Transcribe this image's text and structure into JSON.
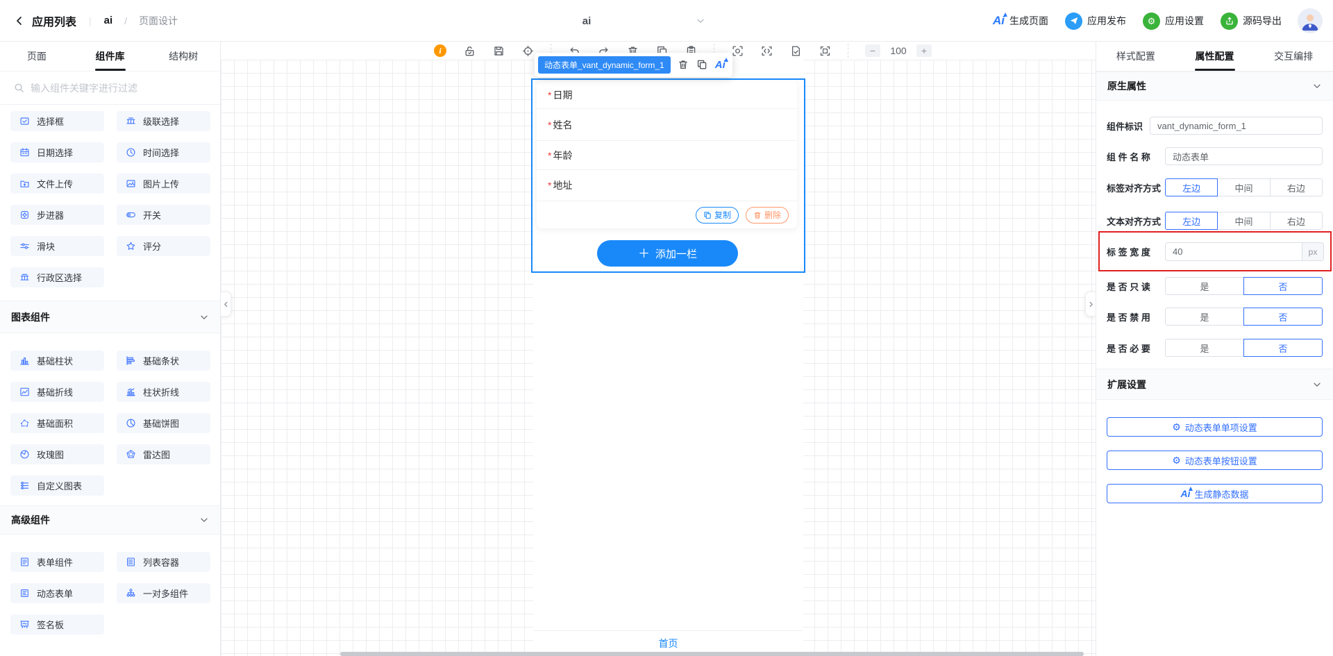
{
  "colors": {
    "primary_blue": "#1989fa",
    "panel_blue": "#3370ff",
    "side_blue": "#4a7dff",
    "ai_blue": "#2979ff",
    "danger_red": "#e02020",
    "required_red": "#ee3b3b",
    "warning_orange": "#ff976a",
    "info_orange": "#ff9800",
    "publish_blue": "#2b9df8",
    "green": "#3ab33a"
  },
  "topbar": {
    "back_label": "应用列表",
    "app_name": "ai",
    "crumb_slash": "/",
    "page_name": "页面设计",
    "page_select_value": "ai",
    "ai_logo_text": "Ai",
    "actions": [
      {
        "label": "生成页面",
        "icon": "ai-logo"
      },
      {
        "label": "应用发布",
        "icon": "paper-plane",
        "circle": "#2b9df8"
      },
      {
        "label": "应用设置",
        "icon": "gear-white",
        "circle": "#3ab33a"
      },
      {
        "label": "源码导出",
        "icon": "export-up",
        "circle": "#3ab33a"
      }
    ]
  },
  "left_panel": {
    "tabs": [
      {
        "label": "页面",
        "active": false
      },
      {
        "label": "组件库",
        "active": true
      },
      {
        "label": "结构树",
        "active": false
      }
    ],
    "search_placeholder": "输入组件关键字进行过滤",
    "sections": [
      {
        "header": null,
        "items": [
          {
            "label": "选择框",
            "icon": "checkbox"
          },
          {
            "label": "级联选择",
            "icon": "cascade"
          },
          {
            "label": "日期选择",
            "icon": "calendar"
          },
          {
            "label": "时间选择",
            "icon": "clock"
          },
          {
            "label": "文件上传",
            "icon": "file-upload"
          },
          {
            "label": "图片上传",
            "icon": "image-upload"
          },
          {
            "label": "步进器",
            "icon": "stepper"
          },
          {
            "label": "开关",
            "icon": "switch"
          },
          {
            "label": "滑块",
            "icon": "slider"
          },
          {
            "label": "评分",
            "icon": "star"
          },
          {
            "label": "行政区选择",
            "icon": "region"
          }
        ]
      },
      {
        "header": "图表组件",
        "items": [
          {
            "label": "基础柱状",
            "icon": "bar-chart"
          },
          {
            "label": "基础条状",
            "icon": "hbar-chart"
          },
          {
            "label": "基础折线",
            "icon": "line-chart"
          },
          {
            "label": "柱状折线",
            "icon": "barline-chart"
          },
          {
            "label": "基础面积",
            "icon": "area-chart"
          },
          {
            "label": "基础饼图",
            "icon": "pie-chart"
          },
          {
            "label": "玫瑰图",
            "icon": "rose-chart"
          },
          {
            "label": "雷达图",
            "icon": "radar-chart"
          },
          {
            "label": "自定义图表",
            "icon": "custom-chart"
          }
        ]
      },
      {
        "header": "高级组件",
        "items": [
          {
            "label": "表单组件",
            "icon": "form"
          },
          {
            "label": "列表容器",
            "icon": "list-container"
          },
          {
            "label": "动态表单",
            "icon": "dynamic-form"
          },
          {
            "label": "一对多组件",
            "icon": "one-to-many"
          },
          {
            "label": "签名板",
            "icon": "signature"
          }
        ]
      }
    ]
  },
  "toolbar": {
    "icon_groups": [
      [
        "info",
        "unlock",
        "save",
        "target"
      ],
      [
        "undo",
        "redo",
        "trash",
        "copy-page",
        "clipboard"
      ],
      [
        "scan",
        "code",
        "doc-check",
        "frame"
      ]
    ],
    "zoom_out": "−",
    "zoom_value": "100",
    "zoom_in": "+"
  },
  "selection_tooltip": {
    "label": "动态表单_vant_dynamic_form_1",
    "ai_text": "Ai"
  },
  "canvas": {
    "form_fields": [
      {
        "required": "*",
        "label": "日期"
      },
      {
        "required": "*",
        "label": "姓名"
      },
      {
        "required": "*",
        "label": "年龄"
      },
      {
        "required": "*",
        "label": "地址"
      }
    ],
    "copy_button": "复制",
    "delete_button": "删除",
    "add_button_plus": "＋",
    "add_button_label": "添加一栏",
    "bottom_tab": "首页"
  },
  "right_panel": {
    "tabs": [
      {
        "label": "样式配置",
        "active": false
      },
      {
        "label": "属性配置",
        "active": true
      },
      {
        "label": "交互编排",
        "active": false
      }
    ],
    "native_section_title": "原生属性",
    "fields": {
      "component_id": {
        "label": "组件标识",
        "value": "vant_dynamic_form_1"
      },
      "component_name": {
        "label": "组 件 名 称",
        "value": "动态表单"
      },
      "label_align": {
        "label": "标签对齐方式",
        "options": [
          "左边",
          "中间",
          "右边"
        ],
        "selected": "左边"
      },
      "text_align": {
        "label": "文本对齐方式",
        "options": [
          "左边",
          "中间",
          "右边"
        ],
        "selected": "左边"
      },
      "label_width": {
        "label": "标 签 宽 度",
        "value": "40",
        "unit": "px",
        "highlighted": true
      },
      "readonly": {
        "label": "是 否 只 读",
        "options": [
          "是",
          "否"
        ],
        "selected": "否"
      },
      "disabled": {
        "label": "是 否 禁 用",
        "options": [
          "是",
          "否"
        ],
        "selected": "否"
      },
      "required": {
        "label": "是 否 必 要",
        "options": [
          "是",
          "否"
        ],
        "selected": "否"
      }
    },
    "extend_section_title": "扩展设置",
    "extend_buttons": [
      {
        "label": "动态表单单项设置",
        "icon": "gear"
      },
      {
        "label": "动态表单按钮设置",
        "icon": "gear"
      },
      {
        "label": "生成静态数据",
        "icon": "ai-logo"
      }
    ]
  }
}
